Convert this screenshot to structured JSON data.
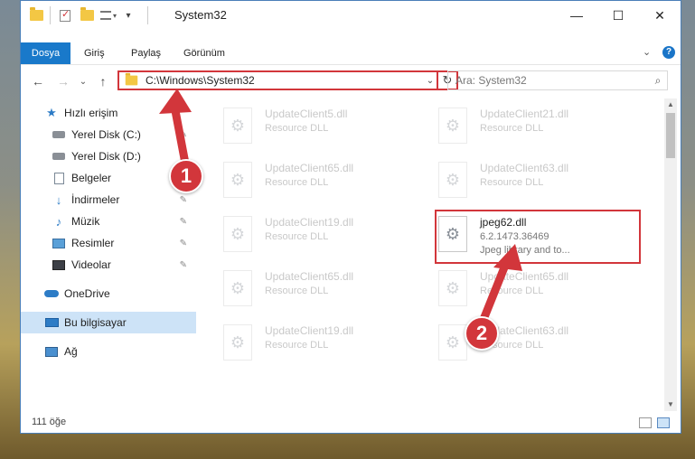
{
  "window": {
    "title": "System32",
    "controls": {
      "minimize": "—",
      "maximize": "☐",
      "close": "✕"
    }
  },
  "ribbon": {
    "tabs": [
      {
        "label": "Dosya",
        "active": true
      },
      {
        "label": "Giriş"
      },
      {
        "label": "Paylaş"
      },
      {
        "label": "Görünüm"
      }
    ],
    "expand": "⌄",
    "help": "?"
  },
  "nav": {
    "back": "←",
    "forward": "→",
    "recent": "⌄",
    "up": "↑",
    "address": "C:\\Windows\\System32",
    "address_dropdown": "⌄",
    "refresh": "↻",
    "search_placeholder": "Ara: System32",
    "search_icon": "⌕"
  },
  "sidebar": {
    "items": [
      {
        "label": "Hızlı erişim",
        "icon": "star-icon"
      },
      {
        "label": "Yerel Disk (C:)",
        "icon": "disk-icon",
        "pinned": true
      },
      {
        "label": "Yerel Disk (D:)",
        "icon": "disk-icon",
        "pinned": true
      },
      {
        "label": "Belgeler",
        "icon": "document-icon",
        "pinned": true
      },
      {
        "label": "İndirmeler",
        "icon": "download-icon",
        "pinned": true
      },
      {
        "label": "Müzik",
        "icon": "music-icon",
        "pinned": true
      },
      {
        "label": "Resimler",
        "icon": "pictures-icon",
        "pinned": true
      },
      {
        "label": "Videolar",
        "icon": "videos-icon",
        "pinned": true
      },
      {
        "label": "OneDrive",
        "icon": "cloud-icon"
      },
      {
        "label": "Bu bilgisayar",
        "icon": "computer-icon",
        "selected": true
      },
      {
        "label": "Ağ",
        "icon": "network-icon"
      }
    ],
    "pin_glyph": "✎"
  },
  "files": [
    {
      "name": "UpdateClient5.dll",
      "type": "Resource DLL",
      "faded": true
    },
    {
      "name": "UpdateClient21.dll",
      "type": "Resource DLL",
      "faded": true
    },
    {
      "name": "UpdateClient65.dll",
      "type": "Resource DLL",
      "faded": true
    },
    {
      "name": "UpdateClient63.dll",
      "type": "Resource DLL",
      "faded": true
    },
    {
      "name": "UpdateClient19.dll",
      "type": "Resource DLL",
      "faded": true
    },
    {
      "name": "jpeg62.dll",
      "type": "6.2.1473.36469",
      "desc": "Jpeg library and to...",
      "faded": false
    },
    {
      "name": "UpdateClient65.dll",
      "type": "Resource DLL",
      "faded": true
    },
    {
      "name": "UpdateClient65.dll",
      "type": "Resource DLL",
      "faded": true
    },
    {
      "name": "UpdateClient19.dll",
      "type": "Resource DLL",
      "faded": true
    },
    {
      "name": "UpdateClient63.dll",
      "type": "Resource DLL",
      "faded": true
    }
  ],
  "file_icon": "⚙",
  "status": {
    "count": "111 öğe"
  },
  "annotations": {
    "step1": "1",
    "step2": "2",
    "color": "#d2363b"
  }
}
